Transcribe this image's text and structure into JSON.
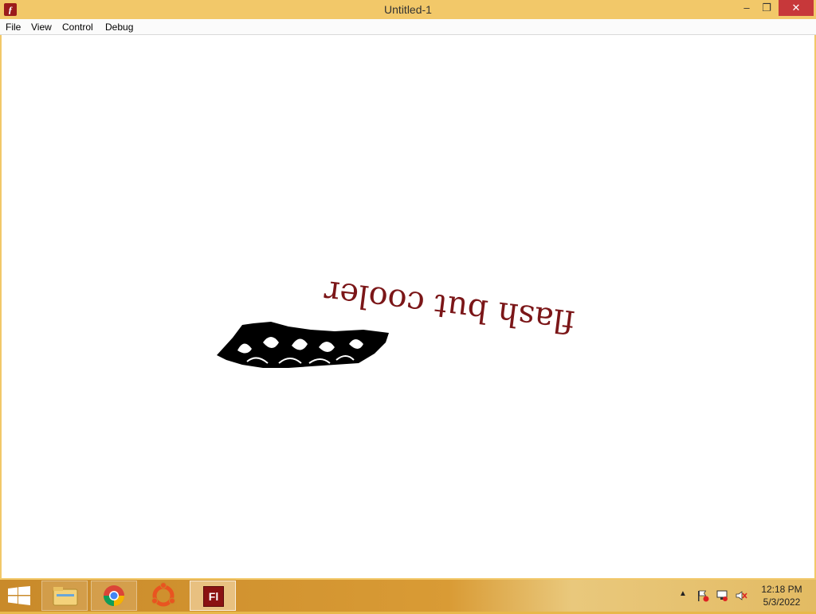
{
  "window": {
    "title": "Untitled-1",
    "app_icon": "flash-player-icon",
    "controls": {
      "minimize": "–",
      "maximize": "❐",
      "close": "✕"
    }
  },
  "menubar": {
    "items": [
      {
        "label": "File"
      },
      {
        "label": "View"
      },
      {
        "label": "Control"
      },
      {
        "label": "Debug"
      }
    ]
  },
  "stage": {
    "text": "flash but cooler",
    "text_color": "#7b1618",
    "text_rotation_deg": 187
  },
  "taskbar": {
    "apps": [
      {
        "icon": "file-explorer-icon"
      },
      {
        "icon": "chrome-icon"
      },
      {
        "icon": "ubuntu-icon"
      },
      {
        "icon": "flash-icon",
        "label": "Fl",
        "active": true
      }
    ],
    "tray_icons": [
      "show-hidden-icons-chevron-icon",
      "action-center-flag-icon",
      "network-icon",
      "volume-muted-icon"
    ],
    "clock": {
      "time": "12:18 PM",
      "date": "5/3/2022"
    }
  }
}
